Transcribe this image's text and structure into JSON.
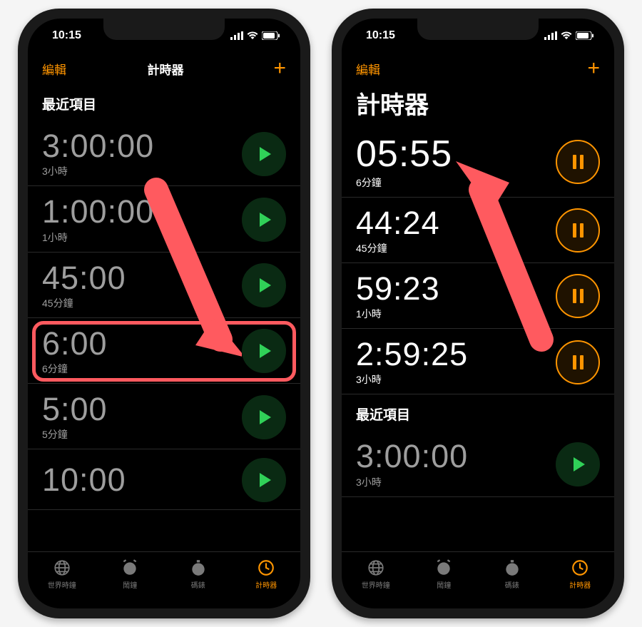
{
  "status": {
    "time": "10:15"
  },
  "nav": {
    "edit": "編輯",
    "title": "計時器",
    "add": "+"
  },
  "colors": {
    "accent": "#ff9500",
    "play": "#30d158",
    "highlight": "#ff5a5f"
  },
  "left": {
    "section_header": "最近項目",
    "rows": [
      {
        "time": "3:00:00",
        "sub": "3小時"
      },
      {
        "time": "1:00:00",
        "sub": "1小時"
      },
      {
        "time": "45:00",
        "sub": "45分鐘"
      },
      {
        "time": "6:00",
        "sub": "6分鐘"
      },
      {
        "time": "5:00",
        "sub": "5分鐘"
      },
      {
        "time": "10:00",
        "sub": ""
      }
    ]
  },
  "right": {
    "running": [
      {
        "time": "05:55",
        "sub": "6分鐘"
      },
      {
        "time": "44:24",
        "sub": "45分鐘"
      },
      {
        "time": "59:23",
        "sub": "1小時"
      },
      {
        "time": "2:59:25",
        "sub": "3小時"
      }
    ],
    "section_header": "最近項目",
    "recent": [
      {
        "time": "3:00:00",
        "sub": "3小時"
      }
    ]
  },
  "tabs": {
    "world": "世界時鐘",
    "alarm": "鬧鐘",
    "stopwatch": "碼錶",
    "timer": "計時器"
  }
}
